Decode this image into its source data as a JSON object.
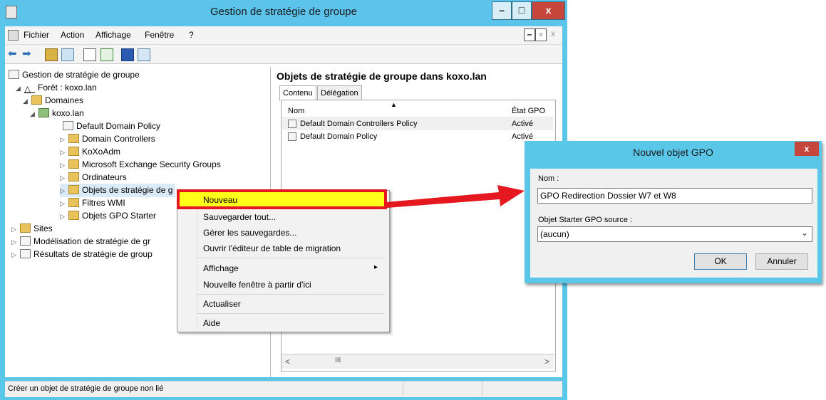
{
  "window": {
    "title": "Gestion de stratégie de groupe",
    "controls": {
      "minimize": "–",
      "maximize": "□",
      "close": "x"
    }
  },
  "menubar": {
    "items": [
      "Fichier",
      "Action",
      "Affichage",
      "Fenêtre",
      "?"
    ],
    "mdi_controls": {
      "minimize": "–",
      "restore": "▫",
      "close": "x"
    }
  },
  "tree": {
    "root": "Gestion de stratégie de groupe",
    "forest": "Forêt : koxo.lan",
    "domains": "Domaines",
    "domain": "koxo.lan",
    "domain_children": [
      "Default Domain Policy",
      "Domain Controllers",
      "KoXoAdm",
      "Microsoft Exchange Security Groups",
      "Ordinateurs",
      "Objets de stratégie de g",
      "Filtres WMI",
      "Objets GPO Starter"
    ],
    "sites": "Sites",
    "modeling": "Modélisation de stratégie de gr",
    "results": "Résultats de stratégie de group"
  },
  "right_pane": {
    "title": "Objets de stratégie de groupe dans koxo.lan",
    "tabs": [
      "Contenu",
      "Délégation"
    ],
    "columns": [
      "Nom",
      "État GPO"
    ],
    "rows": [
      {
        "name": "Default Domain Controllers Policy",
        "state": "Activé"
      },
      {
        "name": "Default Domain Policy",
        "state": "Activé"
      }
    ],
    "scroll": {
      "left": "<",
      "thumb": "III",
      "right": ">"
    }
  },
  "context_menu": {
    "items": [
      "Nouveau",
      "Sauvegarder tout...",
      "Gérer les sauvegardes...",
      "Ouvrir l'éditeur de table de migration",
      "Affichage",
      "Nouvelle fenêtre à partir d'ici",
      "Actualiser",
      "Aide"
    ],
    "submenu_arrow": "▸"
  },
  "status_bar": {
    "text": "Créer un objet de stratégie de groupe non lié"
  },
  "dialog": {
    "title": "Nouvel objet GPO",
    "close": "x",
    "name_label": "Nom :",
    "name_value": "GPO Redirection Dossier W7 et W8",
    "starter_label": "Objet Starter GPO source :",
    "starter_value": "(aucun)",
    "ok": "OK",
    "cancel": "Annuler"
  },
  "colors": {
    "title_bar": "#5bc7e8",
    "highlight": "#ffff1a",
    "annotation_red": "#e5181f",
    "close_button": "#c7463b"
  }
}
